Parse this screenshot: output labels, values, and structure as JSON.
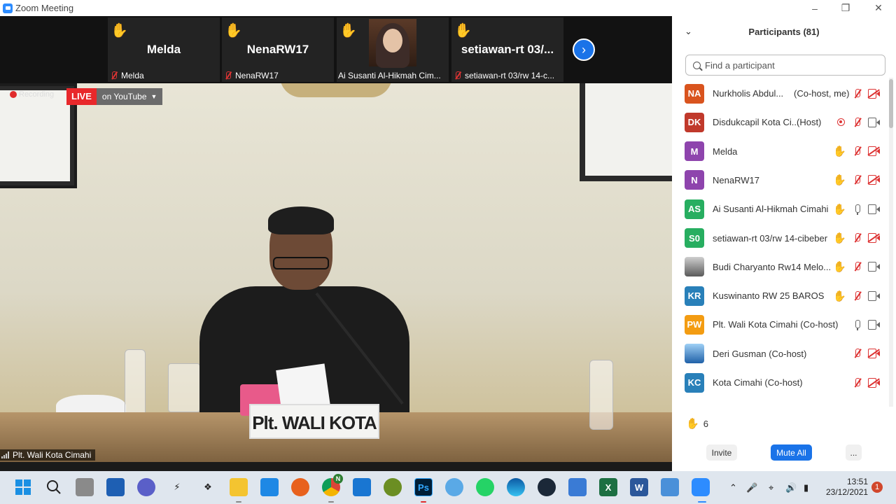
{
  "window": {
    "title": "Zoom Meeting"
  },
  "strip": {
    "tiles": [
      {
        "name": "Melda",
        "label": "Melda"
      },
      {
        "name": "NenaRW17",
        "label": "NenaRW17"
      },
      {
        "name": "",
        "label": "Ai Susanti Al-Hikmah Cim..."
      },
      {
        "name": "setiawan-rt  03/...",
        "label": "setiawan-rt 03/rw 14-c..."
      }
    ]
  },
  "stage": {
    "recording_label": "Recording",
    "live_badge": "LIVE",
    "live_target": "on YouTube",
    "nameplate": "Plt. WALI KOTA",
    "speaker_label": "Plt. Wali Kota Cimahi"
  },
  "participants": {
    "title": "Participants (81)",
    "search_placeholder": "Find a participant",
    "list": [
      {
        "initials": "NA",
        "color": "#d9541e",
        "name": "Nurkholis Abdul...",
        "tag": "(Co-host, me)",
        "hand": false,
        "mic": "muted",
        "cam": "off"
      },
      {
        "initials": "DK",
        "color": "#c0392b",
        "name": "Disdukcapil Kota Ci...",
        "tag": "(Host)",
        "hand": false,
        "mic": "muted",
        "cam": "on",
        "recording": true
      },
      {
        "initials": "M",
        "color": "#8e44ad",
        "name": "Melda",
        "tag": "",
        "hand": true,
        "mic": "muted",
        "cam": "off"
      },
      {
        "initials": "N",
        "color": "#8e44ad",
        "name": "NenaRW17",
        "tag": "",
        "hand": true,
        "mic": "muted",
        "cam": "off"
      },
      {
        "initials": "AS",
        "color": "#27ae60",
        "name": "Ai Susanti Al-Hikmah Cimahi",
        "tag": "",
        "hand": true,
        "mic": "on",
        "cam": "on"
      },
      {
        "initials": "S0",
        "color": "#27ae60",
        "name": "setiawan-rt 03/rw 14-cibeber",
        "tag": "",
        "hand": true,
        "mic": "muted",
        "cam": "off"
      },
      {
        "initials": "",
        "color": "#555555",
        "name": "Budi Charyanto Rw14 Melo...",
        "tag": "",
        "hand": true,
        "mic": "muted",
        "cam": "on",
        "photo": "dark"
      },
      {
        "initials": "KR",
        "color": "#2980b9",
        "name": "Kuswinanto RW 25 BAROS",
        "tag": "",
        "hand": true,
        "mic": "muted",
        "cam": "on"
      },
      {
        "initials": "PW",
        "color": "#f39c12",
        "name": "Plt. Wali Kota Cimahi (Co-host)",
        "tag": "",
        "hand": false,
        "mic": "on",
        "cam": "on"
      },
      {
        "initials": "",
        "color": "#2061a8",
        "name": "Deri Gusman (Co-host)",
        "tag": "",
        "hand": false,
        "mic": "muted",
        "cam": "off",
        "photo": "blue"
      },
      {
        "initials": "KC",
        "color": "#2980b9",
        "name": "Kota Cimahi (Co-host)",
        "tag": "",
        "hand": false,
        "mic": "muted",
        "cam": "off"
      }
    ],
    "raised_hands": "6",
    "invite": "Invite",
    "mute_all": "Mute All",
    "more": "..."
  },
  "taskbar": {
    "time": "13:51",
    "date": "23/12/2021",
    "notifications": "1",
    "chrome_badge": "N"
  }
}
